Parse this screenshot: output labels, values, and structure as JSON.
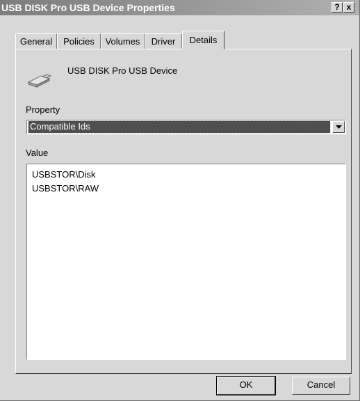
{
  "window": {
    "title": "USB DISK Pro USB Device Properties",
    "help_label": "?",
    "close_label": "x"
  },
  "tabs": [
    {
      "label": "General",
      "active": false
    },
    {
      "label": "Policies",
      "active": false
    },
    {
      "label": "Volumes",
      "active": false
    },
    {
      "label": "Driver",
      "active": false
    },
    {
      "label": "Details",
      "active": true
    }
  ],
  "details": {
    "device_name": "USB DISK Pro USB Device",
    "device_icon": "usb-drive-icon",
    "property_label": "Property",
    "property_selected": "Compatible Ids",
    "value_label": "Value",
    "values": [
      "USBSTOR\\Disk",
      "USBSTOR\\RAW"
    ]
  },
  "buttons": {
    "ok_label": "OK",
    "cancel_label": "Cancel"
  },
  "colors": {
    "face": "#d8d8d8",
    "selection": "#4f4f4f",
    "title_start": "#7d7d7d",
    "title_end": "#b0b0b0"
  }
}
